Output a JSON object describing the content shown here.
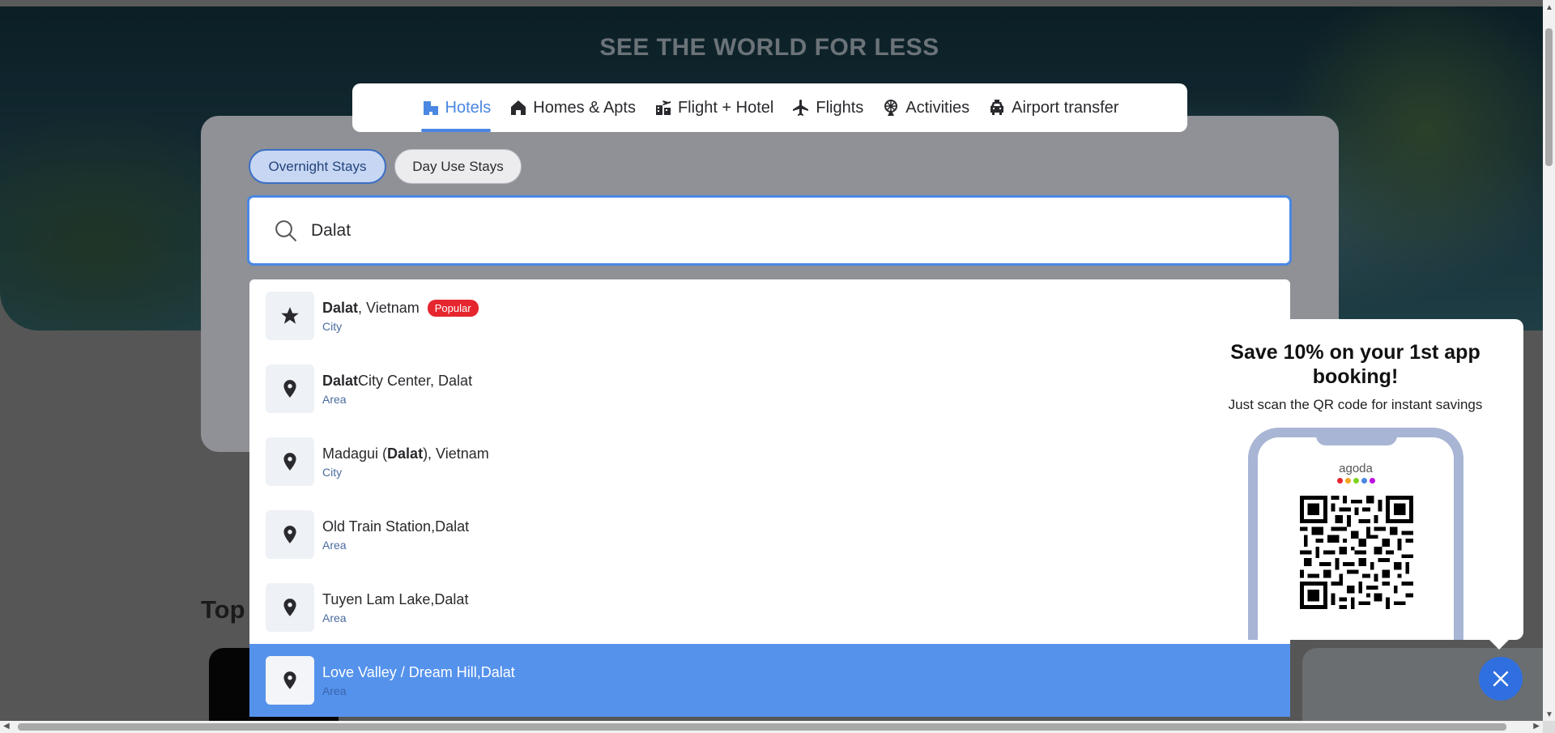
{
  "hero": {
    "title": "SEE THE WORLD FOR LESS"
  },
  "tabs": [
    {
      "label": "Hotels",
      "icon": "hotel-icon",
      "active": true
    },
    {
      "label": "Homes & Apts",
      "icon": "home-icon"
    },
    {
      "label": "Flight + Hotel",
      "icon": "flight-hotel-icon"
    },
    {
      "label": "Flights",
      "icon": "plane-icon"
    },
    {
      "label": "Activities",
      "icon": "ferris-wheel-icon"
    },
    {
      "label": "Airport transfer",
      "icon": "car-icon"
    }
  ],
  "stay_type": {
    "overnight": "Overnight Stays",
    "day_use": "Day Use Stays",
    "selected": "Overnight Stays"
  },
  "search": {
    "value": "Dalat",
    "icon": "search-icon"
  },
  "suggestions": [
    {
      "pre": "",
      "bold": "Dalat",
      "post": ", Vietnam",
      "type": "City",
      "icon": "star-icon",
      "badge": "Popular"
    },
    {
      "pre": "",
      "bold": "Dalat",
      "post": " City Center, Dalat",
      "type": "Area",
      "icon": "map-pin-icon"
    },
    {
      "pre": "Madagui (",
      "bold": "Dalat",
      "post": "), Vietnam",
      "type": "City",
      "icon": "map-pin-icon"
    },
    {
      "pre": "Old Train Station, ",
      "bold": "",
      "post": "Dalat",
      "type": "Area",
      "icon": "map-pin-icon"
    },
    {
      "pre": "Tuyen Lam Lake, ",
      "bold": "",
      "post": "Dalat",
      "type": "Area",
      "icon": "map-pin-icon"
    },
    {
      "pre": "Love Valley / Dream Hill, ",
      "bold": "",
      "post": "Dalat",
      "type": "Area",
      "icon": "map-pin-icon",
      "highlighted": true
    }
  ],
  "section": {
    "heading": "Top"
  },
  "promo": {
    "title": "Save 10% on your 1st app booking!",
    "subtitle": "Just scan the QR code for instant savings",
    "brand": "agoda",
    "brand_dots": [
      "#e5262f",
      "#f5a623",
      "#7ed321",
      "#4a87e3",
      "#bd10e0"
    ]
  },
  "colors": {
    "accent": "#4a87e3",
    "highlight": "#5592ec",
    "badge": "#e5262f"
  }
}
